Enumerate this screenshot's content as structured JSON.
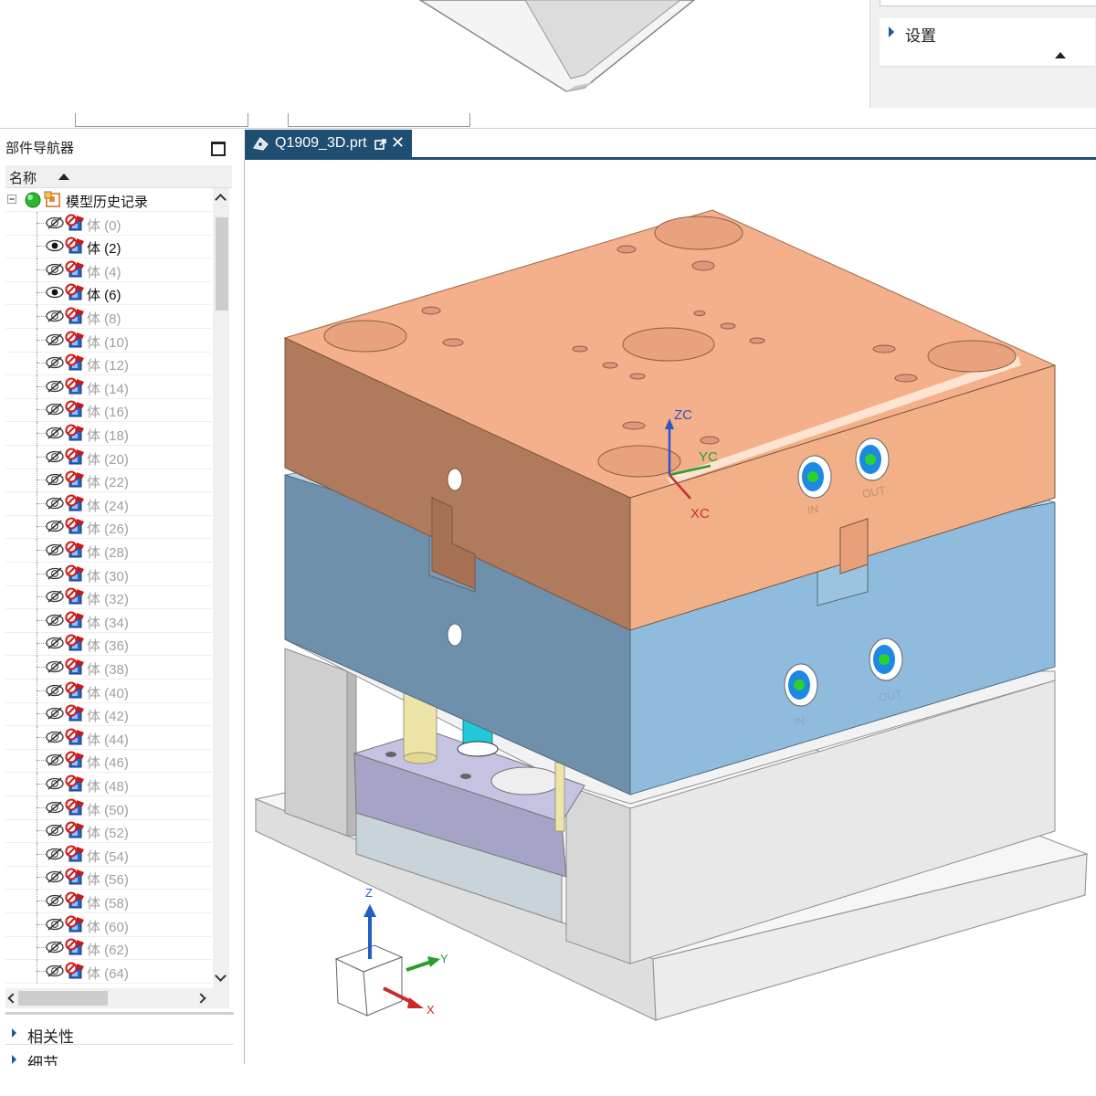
{
  "settings_panel": {
    "settings_label": "设置"
  },
  "navigator": {
    "title": "部件导航器",
    "column_name": "名称",
    "root_label": "模型历史记录",
    "items": [
      {
        "label": "体 (0)",
        "visible": false
      },
      {
        "label": "体 (2)",
        "visible": true
      },
      {
        "label": "体 (4)",
        "visible": false
      },
      {
        "label": "体 (6)",
        "visible": true
      },
      {
        "label": "体 (8)",
        "visible": false
      },
      {
        "label": "体 (10)",
        "visible": false
      },
      {
        "label": "体 (12)",
        "visible": false
      },
      {
        "label": "体 (14)",
        "visible": false
      },
      {
        "label": "体 (16)",
        "visible": false
      },
      {
        "label": "体 (18)",
        "visible": false
      },
      {
        "label": "体 (20)",
        "visible": false
      },
      {
        "label": "体 (22)",
        "visible": false
      },
      {
        "label": "体 (24)",
        "visible": false
      },
      {
        "label": "体 (26)",
        "visible": false
      },
      {
        "label": "体 (28)",
        "visible": false
      },
      {
        "label": "体 (30)",
        "visible": false
      },
      {
        "label": "体 (32)",
        "visible": false
      },
      {
        "label": "体 (34)",
        "visible": false
      },
      {
        "label": "体 (36)",
        "visible": false
      },
      {
        "label": "体 (38)",
        "visible": false
      },
      {
        "label": "体 (40)",
        "visible": false
      },
      {
        "label": "体 (42)",
        "visible": false
      },
      {
        "label": "体 (44)",
        "visible": false
      },
      {
        "label": "体 (46)",
        "visible": false
      },
      {
        "label": "体 (48)",
        "visible": false
      },
      {
        "label": "体 (50)",
        "visible": false
      },
      {
        "label": "体 (52)",
        "visible": false
      },
      {
        "label": "体 (54)",
        "visible": false
      },
      {
        "label": "体 (56)",
        "visible": false
      },
      {
        "label": "体 (58)",
        "visible": false
      },
      {
        "label": "体 (60)",
        "visible": false
      },
      {
        "label": "体 (62)",
        "visible": false
      },
      {
        "label": "体 (64)",
        "visible": false
      }
    ],
    "sections": [
      "相关性",
      "细节"
    ]
  },
  "tab": {
    "file_name": "Q1909_3D.prt",
    "close_glyph": "✕"
  },
  "viewport": {
    "wcs": {
      "zc": "ZC",
      "yc": "YC",
      "xc": "XC"
    },
    "triad": {
      "z": "Z",
      "y": "Y",
      "x": "X"
    },
    "port_labels": {
      "in": "IN",
      "out": "OUT"
    },
    "colors": {
      "top_plate": "#f3b08a",
      "cavity_plate": "#8fbcdd",
      "frame": "#e4e4e4",
      "ejector_plate": "#b9b6d8",
      "cooling_port": "#1e88e5",
      "accent": "#1f4e73"
    }
  }
}
